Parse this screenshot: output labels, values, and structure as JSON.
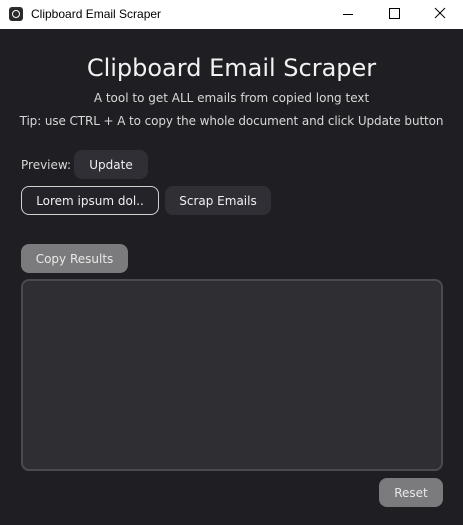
{
  "window": {
    "title": "Clipboard Email Scraper",
    "icon": "app-icon",
    "controls": [
      "minimize-icon",
      "maximize-icon",
      "close-icon"
    ]
  },
  "header": {
    "title": "Clipboard Email Scraper",
    "subtitle": "A tool to get ALL emails from copied long text",
    "tip": "Tip: use CTRL + A to copy the whole document and click Update button"
  },
  "preview": {
    "label": "Preview:",
    "update_label": "Update",
    "text": "Lorem ipsum dol.."
  },
  "actions": {
    "scrap_label": "Scrap Emails",
    "copy_label": "Copy Results",
    "reset_label": "Reset"
  },
  "results": {
    "value": ""
  },
  "colors": {
    "background": "#1f1e22",
    "button": "#302f35",
    "button_disabled": "#7b7b7d",
    "results_bg": "#2e2e33",
    "titlebar": "#ffffff"
  }
}
